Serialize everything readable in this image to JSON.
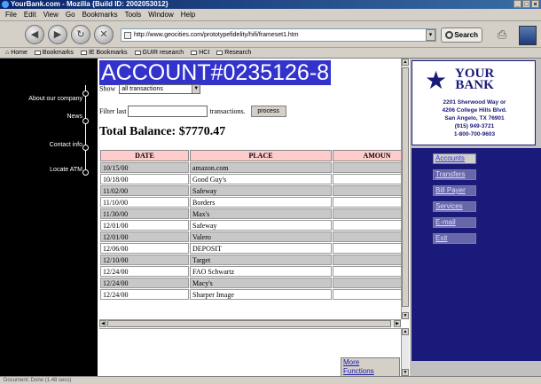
{
  "window": {
    "title": "YourBank.com - Mozilla {Build ID: 2002053012}"
  },
  "menubar": [
    "File",
    "Edit",
    "View",
    "Go",
    "Bookmarks",
    "Tools",
    "Window",
    "Help"
  ],
  "toolbar": {
    "url": "http://www.geocities.com/prototypefidelity/hifi/frameset1.htm",
    "search_label": "Search"
  },
  "bookmarks": [
    "Home",
    "Bookmarks",
    "IE Bookmarks",
    "GUIR research",
    "HCI",
    "Research"
  ],
  "leftnav": {
    "items": [
      "About our company",
      "News",
      "Contact info",
      "Locate ATM"
    ]
  },
  "account": {
    "title": "ACCOUNT#0235126-8",
    "show_label": "Show",
    "show_value": "all transactions",
    "filter_label": "Filter last",
    "filter_value": "",
    "filter_suffix": "transactions.",
    "process_label": "process",
    "balance": "Total Balance: $7770.47"
  },
  "table": {
    "headers": [
      "DATE",
      "PLACE",
      "AMOUN"
    ],
    "rows": [
      [
        "10/15/00",
        "amazon.com",
        ""
      ],
      [
        "10/18/00",
        "Good Guy's",
        ""
      ],
      [
        "11/02/00",
        "Safeway",
        ""
      ],
      [
        "11/10/00",
        "Borders",
        ""
      ],
      [
        "11/30/00",
        "Max's",
        ""
      ],
      [
        "12/01/00",
        "Safeway",
        ""
      ],
      [
        "12/01/00",
        "Valero",
        ""
      ],
      [
        "12/06/00",
        "DEPOSIT",
        ""
      ],
      [
        "12/10/00",
        "Target",
        ""
      ],
      [
        "12/24/00",
        "FAO Schwartz",
        ""
      ],
      [
        "12/24/00",
        "Macy's",
        ""
      ],
      [
        "12/24/00",
        "Sharper Image",
        ""
      ]
    ]
  },
  "more_functions": {
    "line1": "More",
    "line2": "Functions"
  },
  "bank": {
    "logo_line1": "YOUR",
    "logo_line2": "BANK",
    "address1": "2201 Sherwood Way or",
    "address2": "4206 College Hills Blvd.",
    "address3": "San Angelo, TX 76901",
    "phone1": "(915) 949-3721",
    "phone2": "1-800-700-9603"
  },
  "side_menu": [
    "Accounts",
    "Transfers",
    "Bill Payer",
    "Services",
    "E-mail",
    "Exit"
  ],
  "status": {
    "text": "Document: Done (1.48 secs)"
  },
  "colors": {
    "accent": "#3333cc",
    "panel": "#1a1a7a",
    "header": "#ffcccc"
  }
}
